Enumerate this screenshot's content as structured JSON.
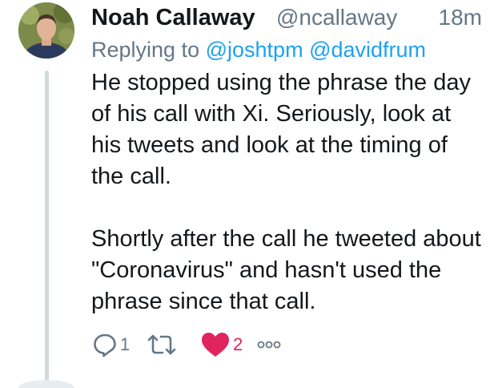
{
  "tweet": {
    "display_name": "Noah Callaway",
    "handle": "@ncallaway",
    "timestamp": "18m",
    "replying_label": "Replying to",
    "replying_to": [
      "@joshtpm",
      "@davidfrum"
    ],
    "paragraphs": [
      "He stopped using the phrase the day of his call with Xi. Seriously, look at his tweets and look at the timing of the call.",
      "Shortly after the call he tweeted about \"Coronavirus\" and hasn't used the phrase since that call."
    ],
    "actions": {
      "reply_count": "1",
      "retweet_count": "",
      "like_count": "2"
    }
  },
  "colors": {
    "text": "#14171a",
    "muted": "#657786",
    "link": "#1da1f2",
    "like": "#e0245e",
    "thread_line": "#cfd9de"
  },
  "icons": [
    "reply-icon",
    "retweet-icon",
    "heart-icon",
    "more-icon"
  ]
}
